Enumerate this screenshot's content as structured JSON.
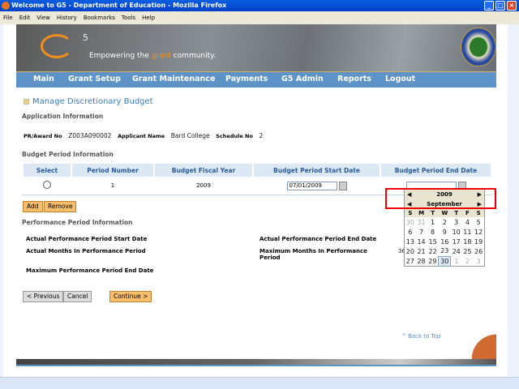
{
  "window": {
    "title": "Welcome to G5 - Department of Education - Mozilla Firefox"
  },
  "menubar": [
    "File",
    "Edit",
    "View",
    "History",
    "Bookmarks",
    "Tools",
    "Help"
  ],
  "banner": {
    "logo": "G5",
    "five": "5",
    "tagline_pre": "Empowering the ",
    "tagline_accent": "grant",
    "tagline_post": " community.",
    "seal": "Department of Education seal"
  },
  "nav": [
    "Main",
    "Grant Setup",
    "Grant Maintenance",
    "Payments",
    "G5 Admin",
    "Reports",
    "Logout"
  ],
  "page_title": "Manage Discretionary Budget",
  "application": {
    "heading": "Application Information",
    "award_label": "PR/Award No",
    "award": "Z003A090002",
    "applicant_label": "Applicant Name",
    "applicant": "Bard College",
    "schedule_label": "Schedule No",
    "schedule": "2"
  },
  "budget": {
    "heading": "Budget Period Information",
    "columns": [
      "Select",
      "Period Number",
      "Budget Fiscal Year",
      "Budget Period Start Date",
      "Budget Period End Date"
    ],
    "row": {
      "period": "1",
      "year": "2009",
      "start": "07/01/2009",
      "end": ""
    },
    "add": "Add",
    "remove": "Remove"
  },
  "performance": {
    "heading": "Performance Period Information",
    "start": "Actual Performance Period Start Date",
    "end": "Actual Performance Period End Date",
    "months": "Actual Months In Performance Period",
    "max_months": "Maximum Months In Performance Period",
    "max_months_value": "36",
    "max_end": "Maximum Performance Period End Date"
  },
  "buttons": {
    "previous": "< Previous",
    "cancel": "Cancel",
    "continue": "Continue >"
  },
  "back_to_top": "^ Back to Top",
  "calendar": {
    "year": "2009",
    "month": "September",
    "dow": [
      "S",
      "M",
      "T",
      "W",
      "T",
      "F",
      "S"
    ],
    "weeks": [
      [
        "30",
        "31",
        "1",
        "2",
        "3",
        "4",
        "5"
      ],
      [
        "6",
        "7",
        "8",
        "9",
        "10",
        "11",
        "12"
      ],
      [
        "13",
        "14",
        "15",
        "16",
        "17",
        "18",
        "19"
      ],
      [
        "20",
        "21",
        "22",
        "23",
        "24",
        "25",
        "26"
      ],
      [
        "27",
        "28",
        "29",
        "30",
        "1",
        "2",
        "3"
      ]
    ],
    "selected": "30"
  }
}
